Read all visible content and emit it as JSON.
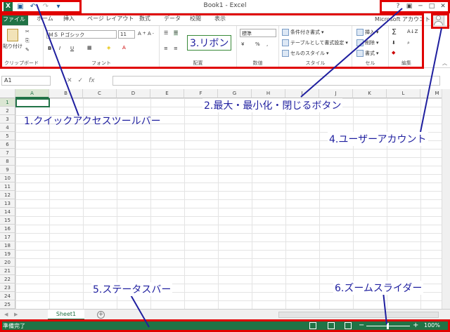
{
  "window": {
    "title": "Book1 - Excel"
  },
  "qat": {
    "icons": [
      "excel-logo",
      "save-icon",
      "undo-icon",
      "redo-icon",
      "customize-icon"
    ]
  },
  "window_controls": {
    "help": "?",
    "ribbon_display": "▣",
    "minimize": "─",
    "maximize": "□",
    "close": "✕"
  },
  "tabs": {
    "file": "ファイル",
    "items": [
      "ホーム",
      "挿入",
      "ページ レイアウト",
      "数式",
      "データ",
      "校閲",
      "表示"
    ],
    "account": "Microsoft アカウント"
  },
  "ribbon": {
    "clipboard": {
      "paste": "貼り付け",
      "label": "クリップボード"
    },
    "font": {
      "font_name": "ＭＳ Ｐゴシック",
      "font_size": "11",
      "bold": "B",
      "italic": "I",
      "underline": "U",
      "label": "フォント"
    },
    "alignment": {
      "label": "配置"
    },
    "number": {
      "format": "標準",
      "percent": "%",
      "comma": ",",
      "label": "数値"
    },
    "styles": {
      "conditional": "条件付き書式",
      "table": "テーブルとして書式設定",
      "cell_style": "セルのスタイル",
      "label": "スタイル"
    },
    "cells": {
      "insert": "挿入",
      "delete": "削除",
      "format": "書式",
      "label": "セル"
    },
    "editing": {
      "sum": "Σ",
      "label": "編集"
    }
  },
  "formula_bar": {
    "name_box": "A1",
    "fx": "fx",
    "cancel": "✕",
    "enter": "✓"
  },
  "grid": {
    "columns": [
      "A",
      "B",
      "C",
      "D",
      "E",
      "F",
      "G",
      "H",
      "I",
      "J",
      "K",
      "L",
      "M"
    ],
    "rows": [
      "1",
      "2",
      "3",
      "4",
      "5",
      "6",
      "7",
      "8",
      "9",
      "10",
      "11",
      "12",
      "13",
      "14",
      "15",
      "16",
      "17",
      "18",
      "19",
      "20",
      "21",
      "22",
      "23",
      "24",
      "25"
    ]
  },
  "sheets": {
    "tabs": [
      "Sheet1"
    ],
    "add": "+"
  },
  "status_bar": {
    "status": "準備完了",
    "zoom_minus": "−",
    "zoom_plus": "+",
    "zoom": "100%",
    "zoom_level": 1.0
  },
  "annotations": {
    "a1": "1.クイックアクセスツールバー",
    "a2": "2.最大・最小化・閉じるボタン",
    "a3": "3.リボン",
    "a4": "4.ユーザーアカウント",
    "a5": "5.ステータスバー",
    "a6": "6.ズームスライダー"
  },
  "colors": {
    "excel_green": "#217346",
    "annotation_red": "#e00000",
    "annotation_blue": "#1f1f9f"
  }
}
